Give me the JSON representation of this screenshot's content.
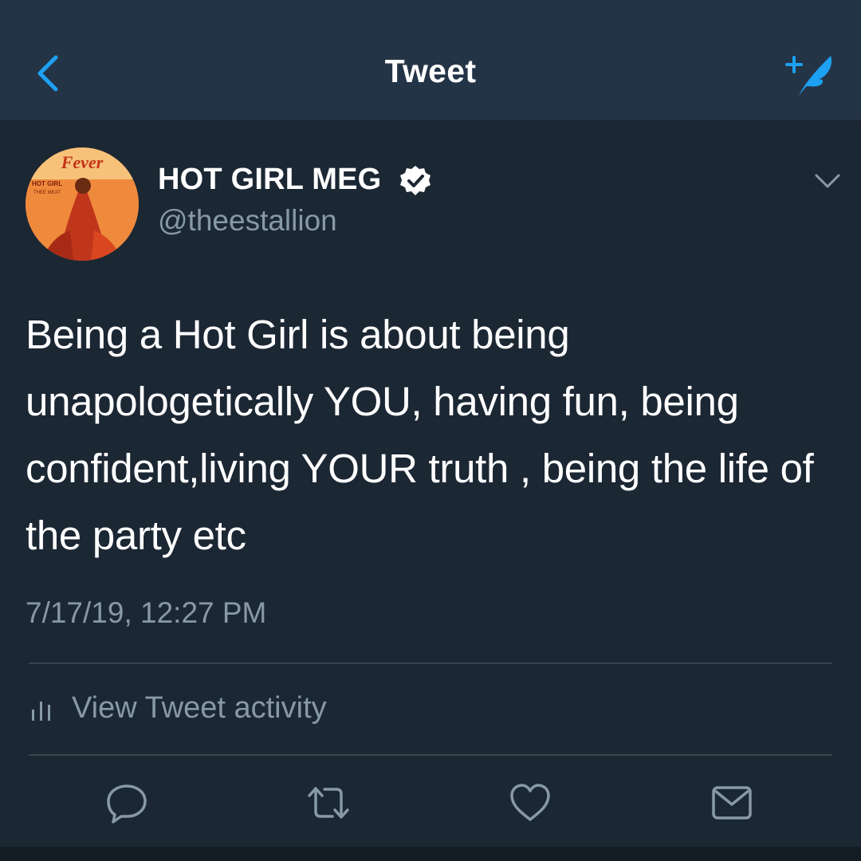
{
  "header": {
    "title": "Tweet",
    "back_icon": "chevron-left-icon",
    "compose_icon": "compose-feather-icon"
  },
  "tweet": {
    "display_name": "HOT GIRL MEG",
    "handle": "@theestallion",
    "verified_icon": "verified-badge-icon",
    "avatar": {
      "description_text": "Fever",
      "lines": [
        "HOT GIRL",
        "THEE MEAT"
      ]
    },
    "text": "Being a Hot Girl is about being unapologetically YOU, having fun, being confident,living YOUR truth , being the life of the party etc",
    "timestamp": "7/17/19, 12:27 PM",
    "activity_label": "View Tweet activity"
  },
  "actions": [
    {
      "name": "reply",
      "icon": "reply-icon"
    },
    {
      "name": "retweet",
      "icon": "retweet-icon"
    },
    {
      "name": "like",
      "icon": "heart-icon"
    },
    {
      "name": "share",
      "icon": "mail-icon"
    }
  ],
  "colors": {
    "background": "#1c2734",
    "header": "#243447",
    "accent": "#1da1f2",
    "secondary_text": "#8899a6",
    "divider": "#38444d"
  }
}
